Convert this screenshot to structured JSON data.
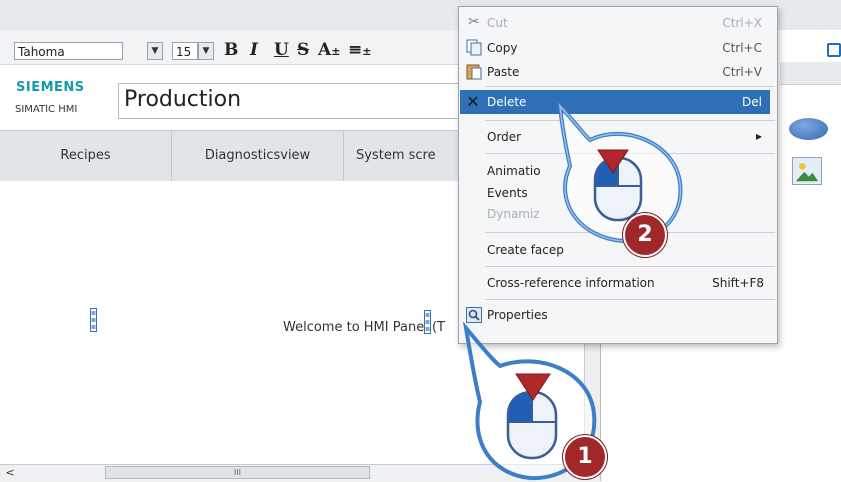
{
  "toolbar": {
    "font_name": "Tahoma",
    "font_size": "15",
    "bold": "B",
    "italic": "I",
    "underline": "U",
    "strike": "S",
    "size_adjust": "A",
    "plus_minus": "±",
    "align": "≡"
  },
  "brand": {
    "company": "SIEMENS",
    "product": "SIMATIC HMI"
  },
  "screen": {
    "title": "Production",
    "nav_buttons": [
      "Recipes",
      "Diagnosticsview",
      "System scre"
    ],
    "welcome_text": "Welcome to HMI Panel (T"
  },
  "scroll": {
    "left_arrow": "<",
    "thumb_grip": "III"
  },
  "context_menu": {
    "items": [
      {
        "label": "Cut",
        "shortcut": "Ctrl+X",
        "enabled": false
      },
      {
        "label": "Copy",
        "shortcut": "Ctrl+C",
        "enabled": true
      },
      {
        "label": "Paste",
        "shortcut": "Ctrl+V",
        "enabled": true
      },
      {
        "label": "Delete",
        "shortcut": "Del",
        "enabled": true,
        "highlighted": true
      },
      {
        "label": "Order",
        "shortcut": "",
        "enabled": true,
        "submenu": true
      },
      {
        "label": "Animatio",
        "shortcut": "",
        "enabled": true
      },
      {
        "label": "Events",
        "shortcut": "",
        "enabled": true
      },
      {
        "label": "Dynamiz",
        "shortcut": "",
        "enabled": false
      },
      {
        "label": "Create facep",
        "shortcut": "",
        "enabled": true
      },
      {
        "label": "Cross-reference information",
        "shortcut": "Shift+F8",
        "enabled": true
      },
      {
        "label": "Properties",
        "shortcut": "",
        "enabled": true
      }
    ],
    "submenu_arrow": "▸"
  },
  "callouts": {
    "step1": "1",
    "step2": "2"
  },
  "colors": {
    "highlight": "#2f6fb7",
    "siemens_teal": "#129bab",
    "callout_badge": "#a0282b",
    "callout_ring": "#3d7ec9",
    "mouse_button": "#1f5fb5"
  },
  "icons": {
    "cut": "scissors-icon",
    "copy": "copy-icon",
    "paste": "paste-icon",
    "delete": "x-icon",
    "properties": "properties-icon"
  }
}
